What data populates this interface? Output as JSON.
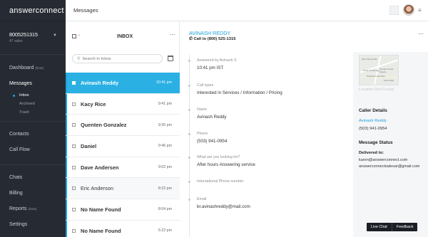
{
  "brand": {
    "name": "answerconnect",
    "dots": "··"
  },
  "account": {
    "number": "8005251315",
    "sub": "47 sales"
  },
  "nav": {
    "dashboard": {
      "label": "Dashboard",
      "tag": "(beta)"
    },
    "messages": {
      "label": "Messages"
    },
    "sub": [
      "Inbox",
      "Archived",
      "Trash"
    ],
    "contacts": {
      "label": "Contacts"
    },
    "callflow": {
      "label": "Call Flow"
    },
    "chats": {
      "label": "Chats"
    },
    "billing": {
      "label": "Billing"
    },
    "reports": {
      "label": "Reports",
      "tag": "(beta)"
    },
    "settings": {
      "label": "Settings"
    }
  },
  "topbar": {
    "title": "Messages",
    "menu_glyph": "≡"
  },
  "inbox": {
    "title": "INBOX",
    "more": "···",
    "search_placeholder": "Search in Inbox",
    "messages": [
      {
        "name": "Avinash Reddy",
        "time": "10:41 pm"
      },
      {
        "name": "Kacy Rice",
        "time": "9:41 pm"
      },
      {
        "name": "Quenten Gonzalez",
        "time": "9:35 pm"
      },
      {
        "name": "Daniel",
        "time": "9:46 pm"
      },
      {
        "name": "Dave Andersen",
        "time": "9:02 pm"
      },
      {
        "name": "Eric Anderson",
        "time": "8:22 pm"
      },
      {
        "name": "No Name Found",
        "time": "8:04 pm"
      },
      {
        "name": "No Name Found",
        "time": "5:22 pm"
      }
    ]
  },
  "detail": {
    "name": "AVINASH REDDY",
    "call": "Call to (800) 525-1315",
    "more": "···",
    "fields": [
      {
        "label": "Answered by Avinash S",
        "value": "10:41 pm IST"
      },
      {
        "label": "Call types",
        "value": "Interested in Services / Information / Pricing"
      },
      {
        "label": "Name",
        "value": "Avinash Reddy"
      },
      {
        "label": "Phone",
        "value": "(503) 941-0954"
      },
      {
        "label": "What are you looking for?",
        "value": "After hours Answering service"
      },
      {
        "label": "International Phone number",
        "value": ""
      },
      {
        "label": "Email",
        "value": "br.avinashreddy@mail.com"
      }
    ]
  },
  "sidepanel": {
    "map_labels": [
      "West Somerville",
      "Powder House Square",
      "North Cambridge",
      "Neighborhood Nine",
      "Somerville"
    ],
    "location": "Location Not Found",
    "caller_details_title": "Caller Details",
    "caller_name": "Avinash Reddy",
    "caller_phone": "(503) 941-0954",
    "message_status_title": "Message Status",
    "delivered_label": "Delivered to:",
    "delivered_to": "karen@answerconnect.com answerconnectsalesar@gmail.com"
  },
  "footer": {
    "live_chat": "Live Chat",
    "feedback": "Feedback"
  }
}
